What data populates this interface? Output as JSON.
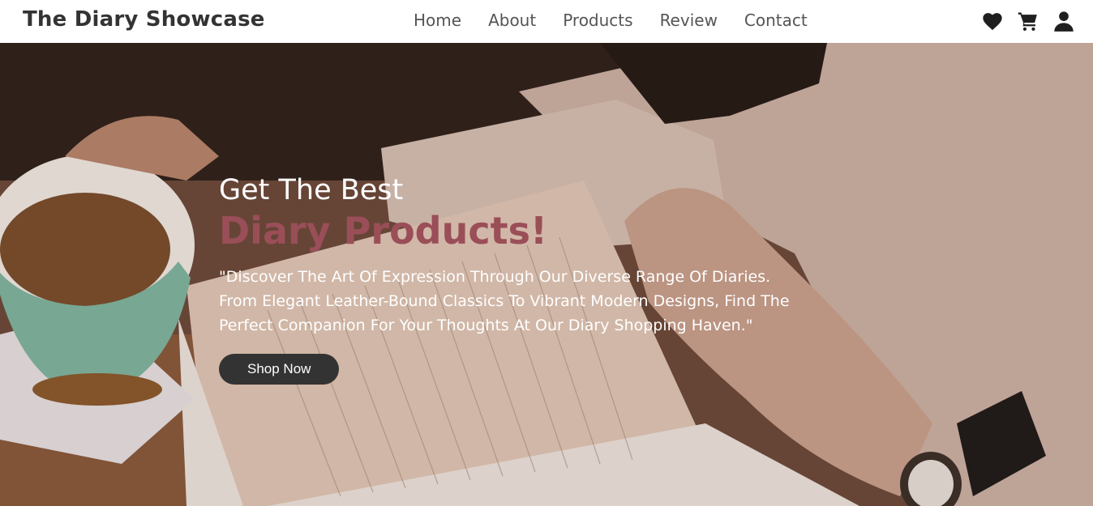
{
  "brand": "The Diary Showcase",
  "nav": {
    "items": [
      "Home",
      "About",
      "Products",
      "Review",
      "Contact"
    ],
    "icons": [
      "heart-icon",
      "cart-icon",
      "user-icon"
    ]
  },
  "hero": {
    "pre_title": "Get The Best",
    "headline": "Diary Products!",
    "description": "\"Discover The Art Of Expression Through Our Diverse Range Of Diaries. From Elegant Leather-Bound Classics To Vibrant Modern Designs, Find The Perfect Companion For Your Thoughts At Our Diary Shopping Haven.\"",
    "cta_label": "Shop Now",
    "headline_color": "#9a4e58"
  }
}
